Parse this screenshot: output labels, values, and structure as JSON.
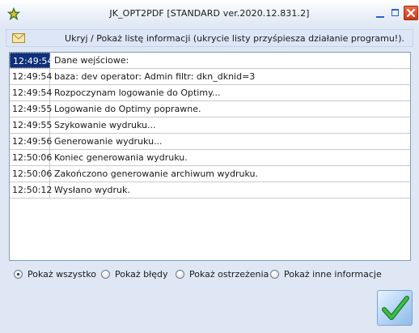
{
  "window": {
    "title": "JK_OPT2PDF [STANDARD ver.2020.12.831.2]"
  },
  "info_bar": {
    "icon": "envelope-icon",
    "text": "Ukryj / Pokaż listę informacji (ukrycie listy przyśpiesza działanie programu!)."
  },
  "log": {
    "selected_index": 0,
    "rows": [
      {
        "time": "12:49:54",
        "message": "Dane wejściowe:"
      },
      {
        "time": "12:49:54",
        "message": "baza: dev operator: Admin filtr: dkn_dknid=3"
      },
      {
        "time": "12:49:54",
        "message": "Rozpoczynam logowanie do Optimy..."
      },
      {
        "time": "12:49:55",
        "message": "Logowanie do Optimy poprawne."
      },
      {
        "time": "12:49:55",
        "message": "Szykowanie wydruku..."
      },
      {
        "time": "12:49:56",
        "message": "Generowanie wydruku..."
      },
      {
        "time": "12:50:06",
        "message": "Koniec generowania wydruku."
      },
      {
        "time": "12:50:06",
        "message": "Zakończono generowanie archiwum wydruku."
      },
      {
        "time": "12:50:12",
        "message": "Wysłano wydruk."
      }
    ]
  },
  "filters": {
    "selected": "all",
    "options": [
      {
        "id": "all",
        "label": "Pokaż wszystko"
      },
      {
        "id": "errors",
        "label": "Pokaż błędy"
      },
      {
        "id": "warnings",
        "label": "Pokaż ostrzeżenia"
      },
      {
        "id": "other",
        "label": "Pokaż inne informacje"
      }
    ]
  },
  "ok_button": {
    "icon": "checkmark-icon"
  },
  "colors": {
    "selection": "#10307a",
    "ok_check": "#2ea83a",
    "close_button": "#e0502c"
  }
}
